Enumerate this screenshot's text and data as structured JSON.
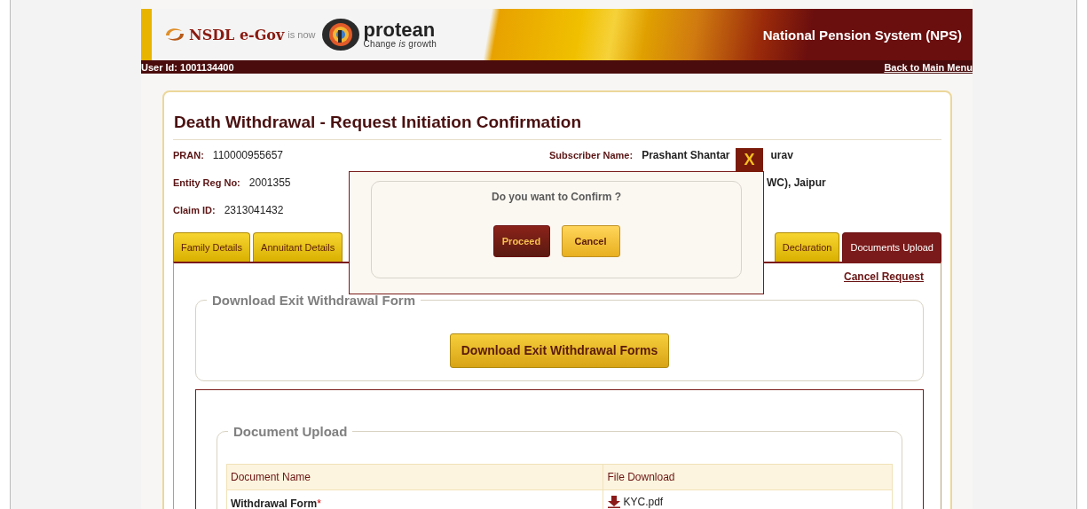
{
  "header": {
    "brand": "NSDL e-Gov",
    "is_now": "is now",
    "logo_name": "protean",
    "tagline": "Change *is* growth",
    "system_title": "National Pension System (NPS)",
    "user_id": "User Id: 1001134400",
    "back_link": "Back to Main Menu"
  },
  "page": {
    "title": "Death Withdrawal - Request Initiation Confirmation",
    "info_left": [
      {
        "label": "PRAN:",
        "value": "110000955657"
      },
      {
        "label": "Entity Reg No:",
        "value": "2001355"
      },
      {
        "label": "Claim ID:",
        "value": "2313041432"
      }
    ],
    "subscriber_label": "Subscriber Name:",
    "subscriber_value_start": "Prashant Shantar",
    "subscriber_value_end": "urav",
    "office_fragment": "WC), Jaipur",
    "tabs_left": [
      {
        "label": "Family Details",
        "selected": false
      },
      {
        "label": "Annuitant Details",
        "selected": false
      }
    ],
    "tabs_right": [
      {
        "label": "Declaration",
        "selected": false
      },
      {
        "label": "Documents Upload",
        "selected": true
      }
    ],
    "cancel_request": "Cancel Request",
    "download_section": {
      "legend": "Download Exit Withdrawal Form",
      "button": "Download Exit Withdrawal Forms"
    },
    "upload_section": {
      "legend": "Document Upload",
      "columns": [
        "Document Name",
        "File Download"
      ],
      "rows": [
        {
          "name": "Withdrawal Form",
          "required_mark": "*",
          "file": "KYC.pdf"
        }
      ]
    }
  },
  "dialog": {
    "close": "X",
    "message": "Do you want to Confirm ?",
    "buttons": [
      {
        "label": "Proceed",
        "kind": "primary"
      },
      {
        "label": "Cancel",
        "kind": "secondary"
      }
    ]
  }
}
